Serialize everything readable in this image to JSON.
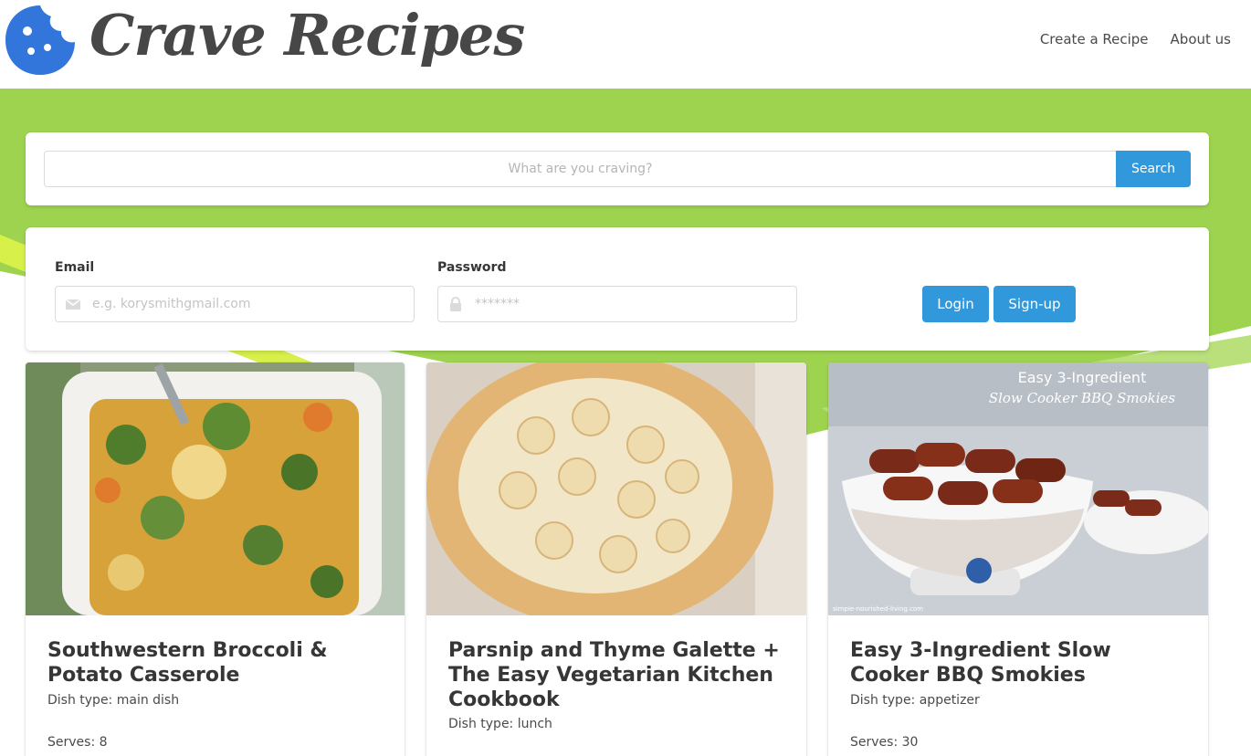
{
  "header": {
    "logo_text": "Crave Recipes",
    "nav": [
      {
        "label": "Create a Recipe"
      },
      {
        "label": "About us"
      }
    ]
  },
  "colors": {
    "accent": "#3298dc",
    "hero_green": "#9ed350",
    "hero_lime": "#d7f04a",
    "logo_blue": "#3275db"
  },
  "search": {
    "placeholder": "What are you craving?",
    "button_label": "Search"
  },
  "login": {
    "email_label": "Email",
    "email_placeholder": "e.g. korysmithgmail.com",
    "password_label": "Password",
    "password_placeholder": "*******",
    "login_label": "Login",
    "signup_label": "Sign-up"
  },
  "recipes": [
    {
      "title": "Southwestern Broccoli & Potato Casserole",
      "dish_type": "Dish type: main dish",
      "serves": "Serves: 8"
    },
    {
      "title": "Parsnip and Thyme Galette + The Easy Vegetarian Kitchen Cookbook",
      "dish_type": "Dish type: lunch",
      "serves": ""
    },
    {
      "title": "Easy 3-Ingredient Slow Cooker BBQ Smokies",
      "dish_type": "Dish type: appetizer",
      "serves": "Serves: 30",
      "image_caption_line1": "Easy 3-Ingredient",
      "image_caption_line2": "Slow Cooker BBQ Smokies",
      "image_watermark": "simple-nourished-living.com"
    }
  ]
}
